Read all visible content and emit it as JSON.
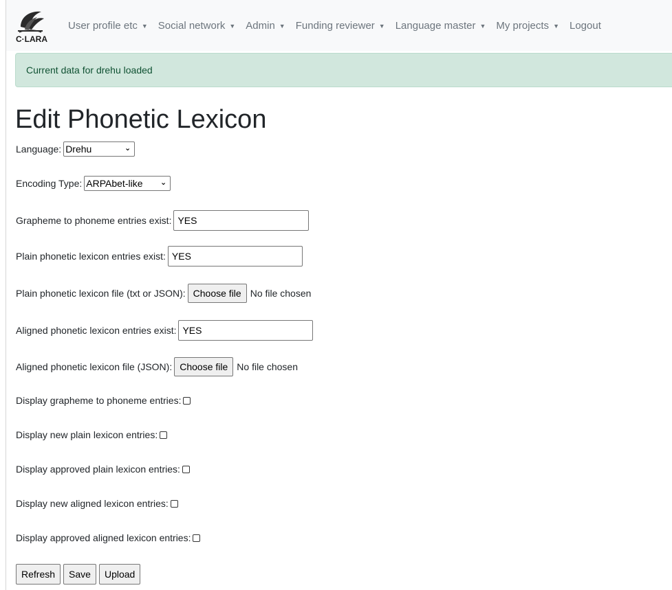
{
  "navbar": {
    "logo_text": "C·LARA",
    "items": [
      {
        "label": "User profile etc"
      },
      {
        "label": "Social network"
      },
      {
        "label": "Admin"
      },
      {
        "label": "Funding reviewer"
      },
      {
        "label": "Language master"
      },
      {
        "label": "My projects"
      },
      {
        "label": "Logout"
      }
    ]
  },
  "alert": {
    "message": "Current data for drehu loaded"
  },
  "page": {
    "title": "Edit Phonetic Lexicon"
  },
  "form": {
    "language": {
      "label": "Language:",
      "value": "Drehu"
    },
    "encoding": {
      "label": "Encoding Type:",
      "value": "ARPAbet-like"
    },
    "g2p_exist": {
      "label": "Grapheme to phoneme entries exist:",
      "value": "YES"
    },
    "plain_exist": {
      "label": "Plain phonetic lexicon entries exist:",
      "value": "YES"
    },
    "plain_file": {
      "label": "Plain phonetic lexicon file (txt or JSON):",
      "button": "Choose file",
      "status": "No file chosen"
    },
    "aligned_exist": {
      "label": "Aligned phonetic lexicon entries exist:",
      "value": "YES"
    },
    "aligned_file": {
      "label": "Aligned phonetic lexicon file (JSON):",
      "button": "Choose file",
      "status": "No file chosen"
    },
    "display_g2p": {
      "label": "Display grapheme to phoneme entries:"
    },
    "display_new_plain": {
      "label": "Display new plain lexicon entries:"
    },
    "display_approved_plain": {
      "label": "Display approved plain lexicon entries:"
    },
    "display_new_aligned": {
      "label": "Display new aligned lexicon entries:"
    },
    "display_approved_aligned": {
      "label": "Display approved aligned lexicon entries:"
    }
  },
  "buttons": {
    "refresh": "Refresh",
    "save": "Save",
    "upload": "Upload"
  },
  "colors": {
    "alert_bg": "#d1e7dd",
    "alert_text": "#0f5132",
    "navbar_bg": "#f8f9fa",
    "nav_text": "#6c757d"
  }
}
